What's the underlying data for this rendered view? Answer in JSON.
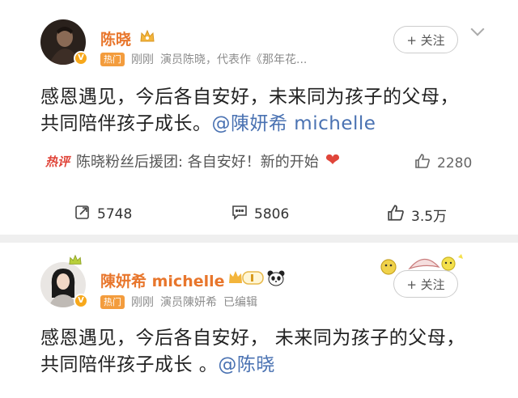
{
  "post1": {
    "username": "陈晓",
    "hot_tag": "热门",
    "meta_time": "刚刚",
    "meta_desc": "演员陈晓，代表作《那年花...",
    "follow_label": "+ 关注",
    "text_line1": "感恩遇见，今后各自安好，未来同为孩子的父母，",
    "text_line2_prefix": "共同陪伴孩子成长。",
    "text_line2_mention": "@陳妍希 michelle",
    "hot_comment": {
      "label": "热评",
      "text": "陈晓粉丝后援团: 各自安好！新的开始",
      "likes": "2280"
    },
    "reposts": "5748",
    "comments": "5806",
    "likes": "3.5万"
  },
  "post2": {
    "username": "陳妍希 michelle",
    "hot_tag": "热门",
    "meta_time": "刚刚",
    "meta_desc": "演员陳妍希",
    "meta_edited": "已编辑",
    "follow_label": "+ 关注",
    "text_line1": "感恩遇见，今后各自安好， 未来同为孩子的父母，",
    "text_line2_prefix": "共同陪伴孩子成长 。",
    "text_line2_mention": "@陈晓"
  },
  "colors": {
    "username": "#e8762c",
    "mention": "#4a72b2",
    "hot_red": "#e0453a",
    "badge_orange": "#f39c3d"
  },
  "icons": {
    "crown": "crown-icon",
    "panda": "panda-icon",
    "repost": "repost-icon",
    "comment": "comment-icon",
    "like": "thumbs-up-icon",
    "heart": "heart-icon"
  }
}
